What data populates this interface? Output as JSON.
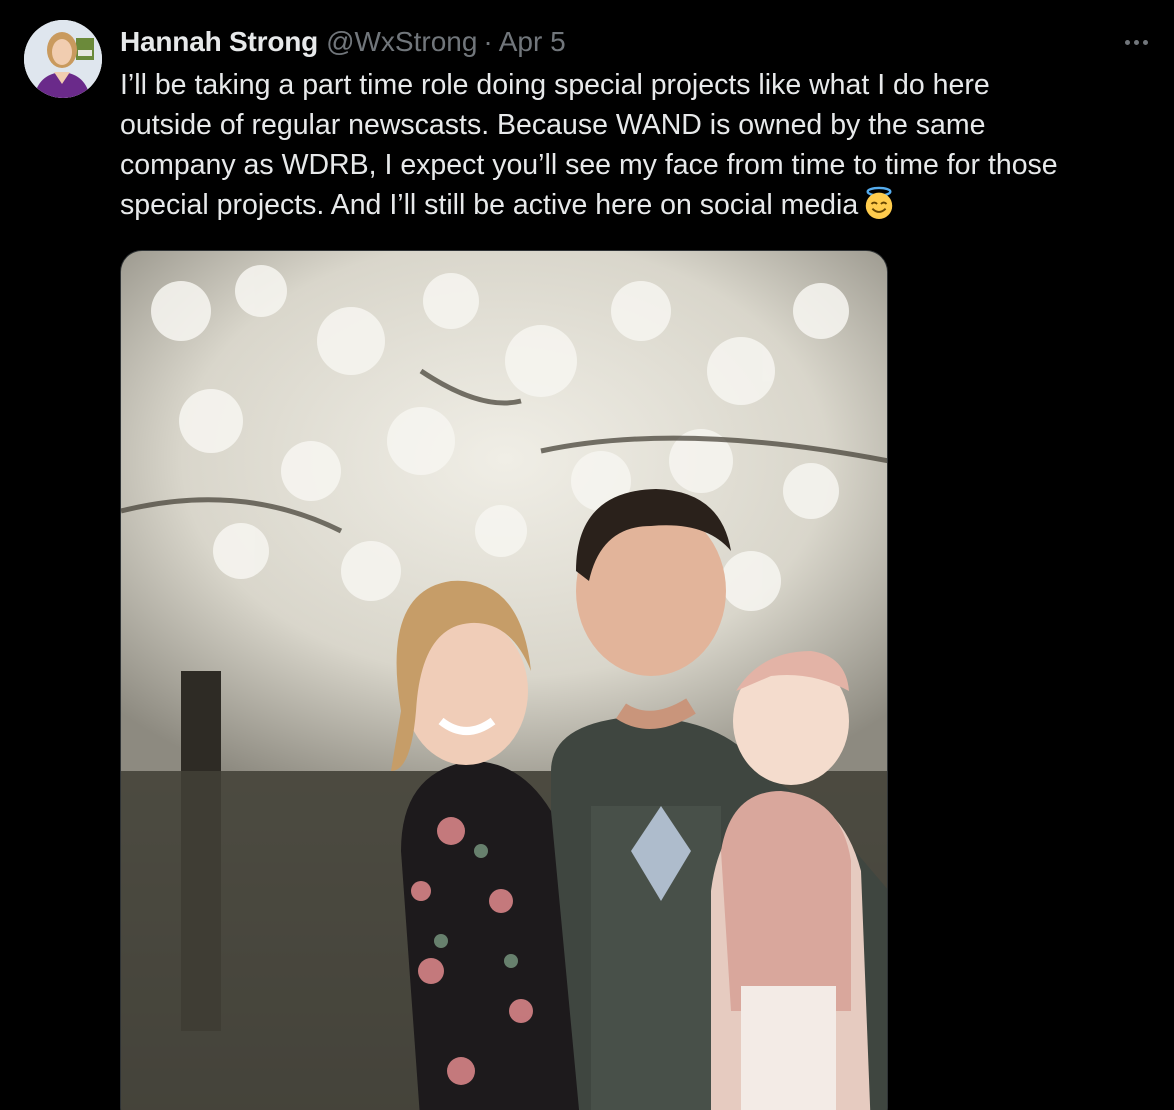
{
  "tweet": {
    "author": {
      "display_name": "Hannah Strong",
      "handle": "@WxStrong",
      "avatar": "profile-photo"
    },
    "separator": "·",
    "date": "Apr 5",
    "more_icon": "more-horizontal-icon",
    "text_lines": [
      "I’ll be taking a part time role doing special projects like what I do here",
      "outside of regular newscasts. Because WAND is owned by the same",
      "company as WDRB, I expect you’ll see my face from time to time for those",
      "special projects. And I’ll still be active here on social media"
    ],
    "emoji": "smiling-face-with-halo-emoji",
    "media": {
      "type": "photo"
    }
  }
}
